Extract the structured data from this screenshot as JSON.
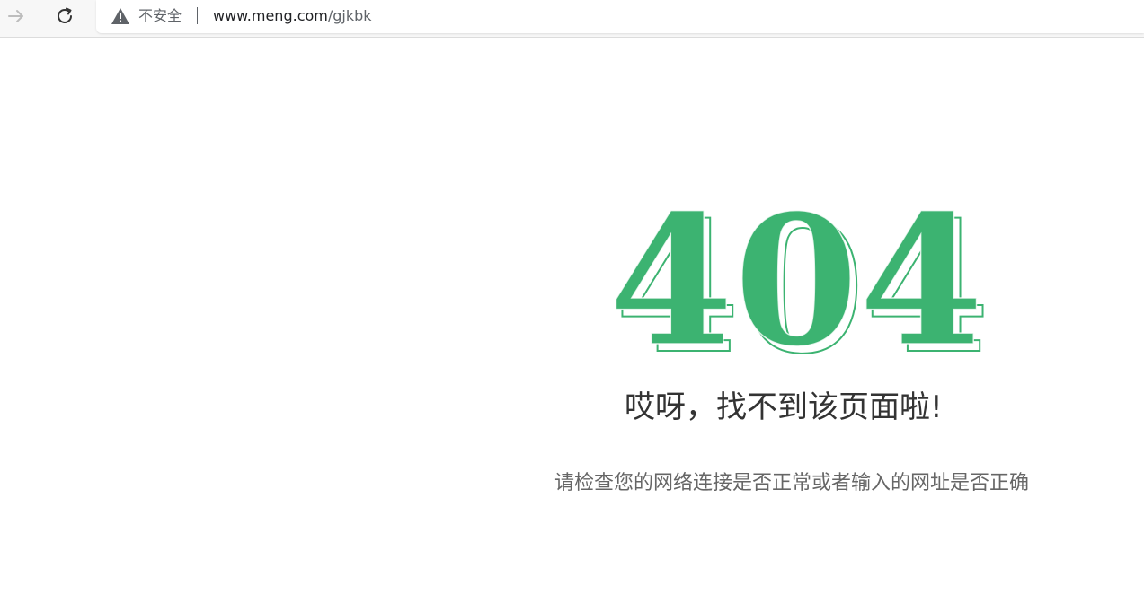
{
  "browser": {
    "security_label": "不安全",
    "url_host": "www.meng.com",
    "url_path": "/gjkbk",
    "icons": {
      "forward": "arrow-right-icon",
      "reload": "reload-icon",
      "warning": "warning-triangle-icon"
    }
  },
  "page": {
    "error_code": "404",
    "headline": "哎呀，找不到该页面啦!",
    "subtext": "请检查您的网络连接是否正常或者输入的网址是否正确",
    "accent_color": "#3cb371"
  }
}
